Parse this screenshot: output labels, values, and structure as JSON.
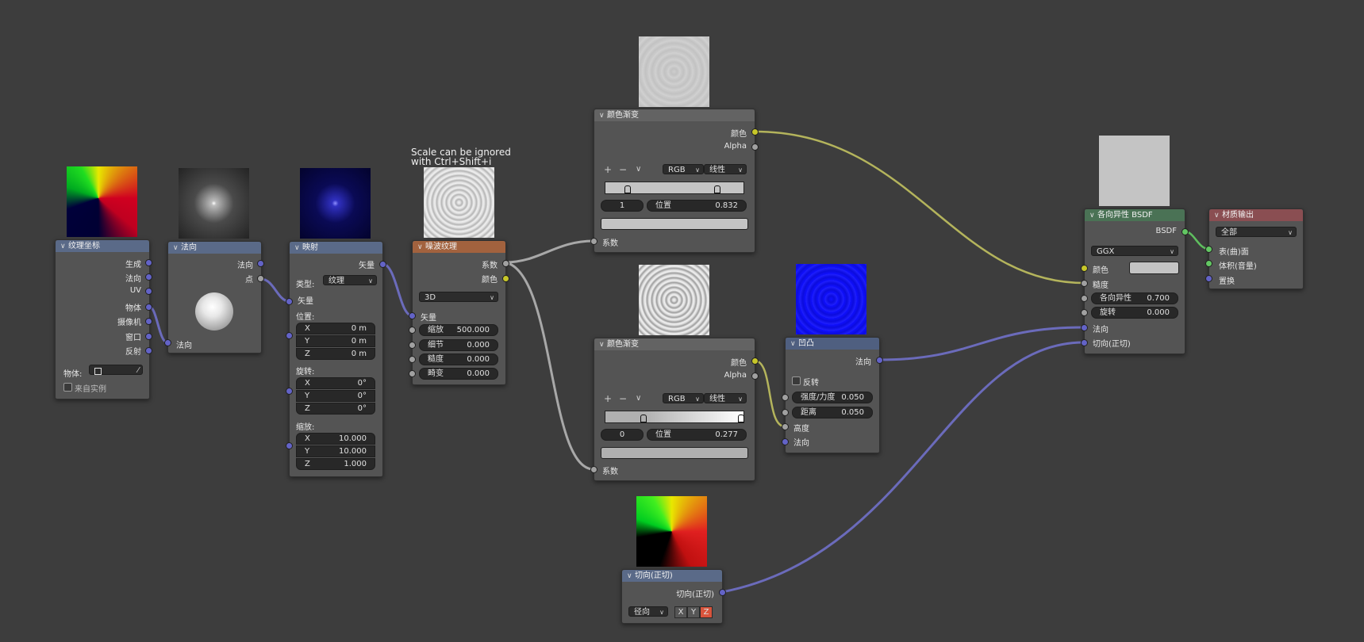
{
  "frame_label": "Scale can be ignored\nwith Ctrl+Shift+i",
  "nodes": {
    "texcoord": {
      "title": "纹理坐标",
      "outputs": [
        "生成",
        "法向",
        "UV",
        "物体",
        "摄像机",
        "窗口",
        "反射"
      ],
      "object_label": "物体:",
      "from_instancer": "来自实例"
    },
    "normal": {
      "title": "法向",
      "outputs": [
        "法向",
        "点"
      ],
      "input": "法向"
    },
    "mapping": {
      "title": "映射",
      "output": "矢量",
      "type_label": "类型:",
      "type_value": "纹理",
      "input": "矢量",
      "location_label": "位置:",
      "location": [
        {
          "axis": "X",
          "value": "0 m"
        },
        {
          "axis": "Y",
          "value": "0 m"
        },
        {
          "axis": "Z",
          "value": "0 m"
        }
      ],
      "rotation_label": "旋转:",
      "rotation": [
        {
          "axis": "X",
          "value": "0°"
        },
        {
          "axis": "Y",
          "value": "0°"
        },
        {
          "axis": "Z",
          "value": "0°"
        }
      ],
      "scale_label": "缩放:",
      "scale": [
        {
          "axis": "X",
          "value": "10.000"
        },
        {
          "axis": "Y",
          "value": "10.000"
        },
        {
          "axis": "Z",
          "value": "1.000"
        }
      ]
    },
    "noise": {
      "title": "噪波纹理",
      "outputs": [
        "系数",
        "颜色"
      ],
      "dimension": "3D",
      "vector_input": "矢量",
      "params": [
        {
          "label": "缩放",
          "value": "500.000"
        },
        {
          "label": "细节",
          "value": "0.000"
        },
        {
          "label": "糙度",
          "value": "0.000"
        },
        {
          "label": "畸变",
          "value": "0.000"
        }
      ]
    },
    "ramp1": {
      "title": "颜色渐变",
      "outputs": [
        "颜色",
        "Alpha"
      ],
      "color_mode": "RGB",
      "interp": "线性",
      "stop_index": "1",
      "pos_label": "位置",
      "pos_value": "0.832",
      "input": "系数"
    },
    "ramp2": {
      "title": "颜色渐变",
      "outputs": [
        "颜色",
        "Alpha"
      ],
      "color_mode": "RGB",
      "interp": "线性",
      "stop_index": "0",
      "pos_label": "位置",
      "pos_value": "0.277",
      "input": "系数"
    },
    "bump": {
      "title": "凹凸",
      "output": "法向",
      "invert": "反转",
      "params": [
        {
          "label": "强度/力度",
          "value": "0.050"
        },
        {
          "label": "距离",
          "value": "0.050"
        }
      ],
      "inputs": [
        "高度",
        "法向"
      ]
    },
    "tangent": {
      "title": "切向(正切)",
      "output": "切向(正切)",
      "direction": "径向",
      "axes": [
        "X",
        "Y",
        "Z"
      ],
      "active_axis": "Z"
    },
    "bsdf": {
      "title": "各向异性 BSDF",
      "output": "BSDF",
      "distribution": "GGX",
      "color_label": "颜色",
      "roughness": "糙度",
      "params": [
        {
          "label": "各向异性",
          "value": "0.700"
        },
        {
          "label": "旋转",
          "value": "0.000"
        }
      ],
      "inputs": [
        "法向",
        "切向(正切)"
      ]
    },
    "output": {
      "title": "材质输出",
      "target": "全部",
      "inputs": [
        "表(曲)面",
        "体积(音量)",
        "置换"
      ]
    }
  },
  "colors": {
    "background": "#3d3d3d",
    "node_body": "#545454",
    "socket_vector": "#6363c7",
    "socket_float": "#a1a1a1",
    "socket_color": "#c7c729",
    "socket_shader": "#63c763",
    "axis_active": "#d8543c"
  }
}
